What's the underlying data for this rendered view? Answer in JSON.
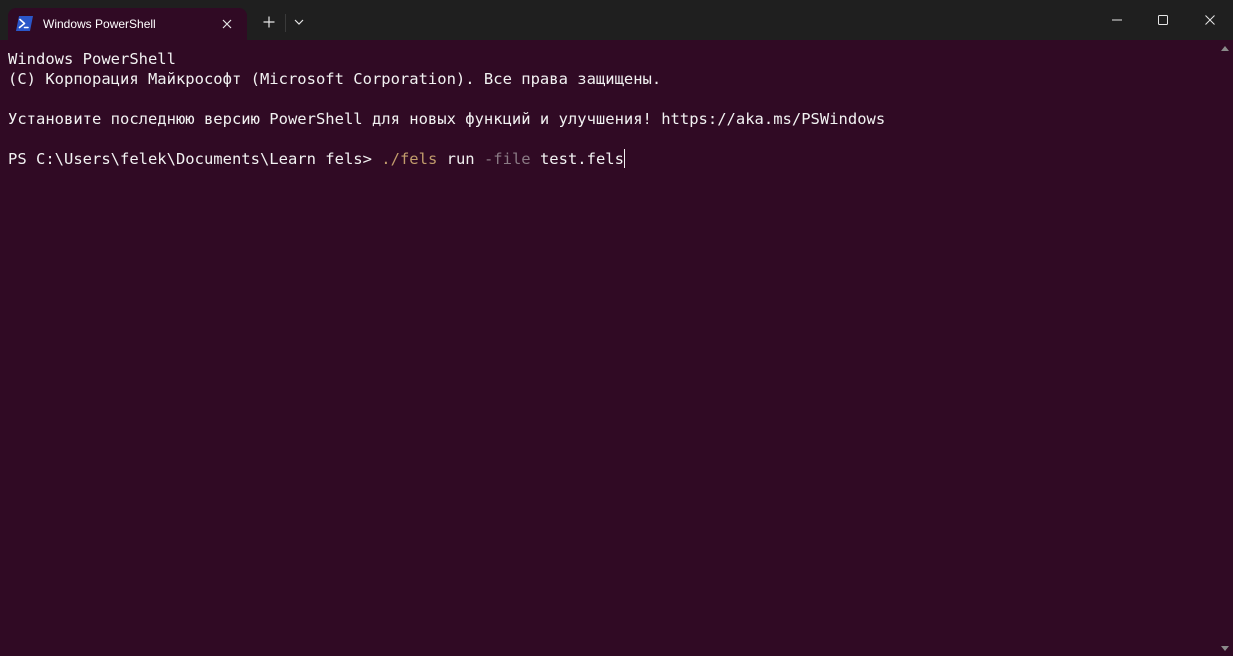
{
  "window": {
    "title": "Windows PowerShell"
  },
  "tabbar": {
    "tab_icon": "powershell-icon",
    "new_tab_icon": "plus-icon",
    "dropdown_icon": "chevron-down-icon",
    "close_icon": "close-icon"
  },
  "window_controls": {
    "minimize_icon": "minimize-icon",
    "maximize_icon": "maximize-icon",
    "close_icon": "close-icon"
  },
  "terminal": {
    "lines": [
      "Windows PowerShell",
      "(C) Корпорация Майкрософт (Microsoft Corporation). Все права защищены.",
      "",
      "Установите последнюю версию PowerShell для новых функций и улучшения! https://aka.ms/PSWindows",
      ""
    ],
    "prompt": "PS C:\\Users\\felek\\Documents\\Learn fels> ",
    "command": {
      "executable": "./fels",
      "argument": " run ",
      "flag": "-file",
      "value": " test.fels"
    }
  },
  "colors": {
    "background": "#300a24",
    "titlebar": "#1f1f1f",
    "foreground": "#f2f2f2",
    "executable": "#c19c6c",
    "flag": "#8a7a84"
  }
}
